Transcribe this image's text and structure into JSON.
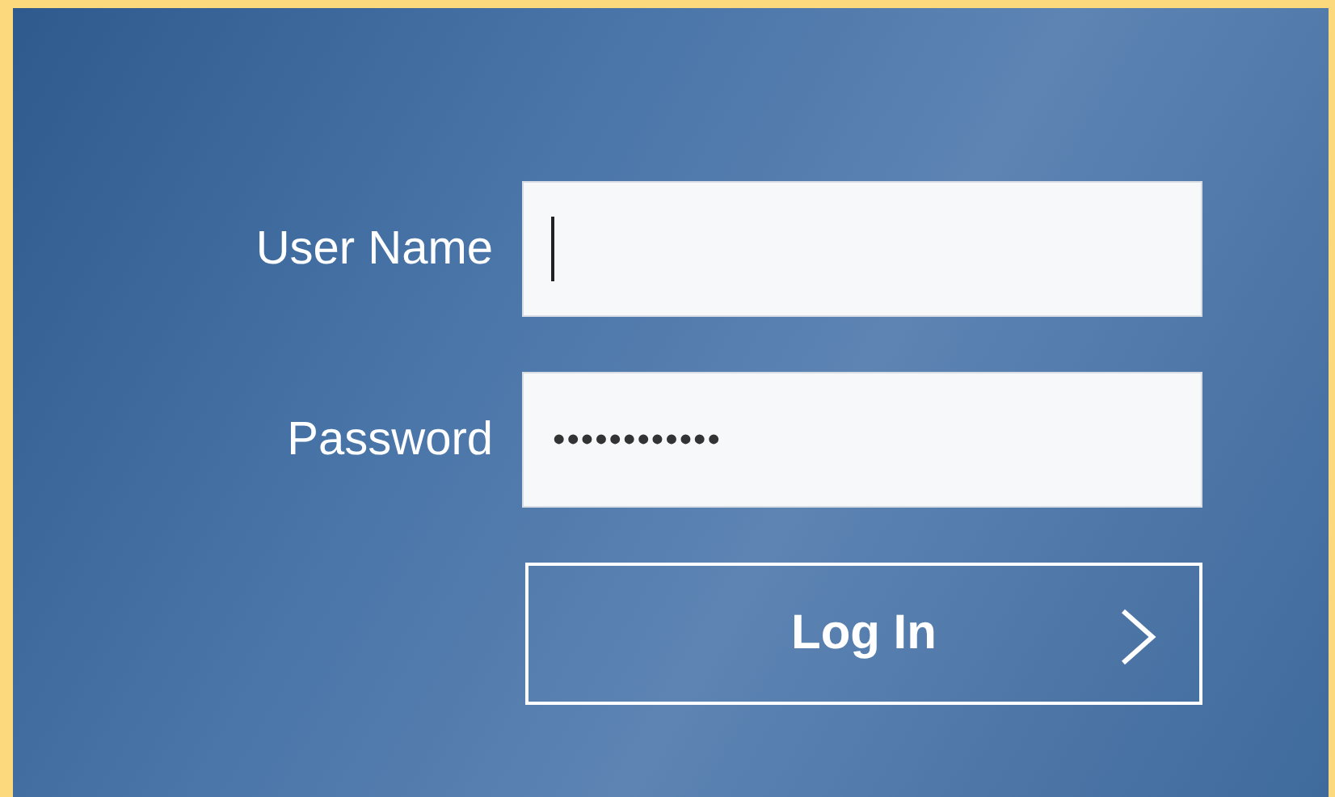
{
  "login_form": {
    "fields": [
      {
        "label": "User Name",
        "focused": true
      },
      {
        "label": "Password",
        "value": "••••••••••••",
        "focused": false
      }
    ],
    "submit_button": {
      "label": "Log In"
    }
  }
}
